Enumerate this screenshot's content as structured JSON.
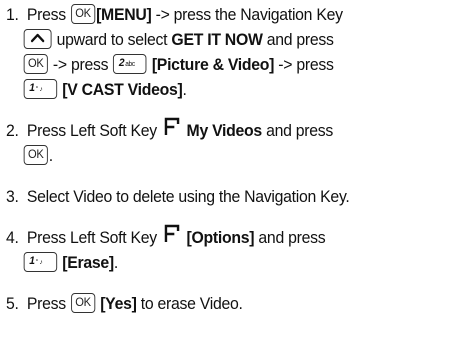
{
  "step1": {
    "num": "1.",
    "press1": "Press",
    "ok_key": "OK",
    "menu": "[MENU]",
    "arrow_text": "-> press the Navigation Key",
    "upward": "upward to select",
    "get_it_now": "GET IT NOW",
    "and_press": "and press",
    "arrow_press": "-> press",
    "key2_digit": "2",
    "key2_sub": "abc",
    "pic_video": "[Picture & Video]",
    "arrow_press2": "-> press",
    "key1_digit": "1",
    "key1_sub": "° ♪",
    "vcast": "[V CAST Videos]",
    "period": "."
  },
  "step2": {
    "num": "2.",
    "text": "Press Left Soft Key",
    "my_videos": "My Videos",
    "and_press": "and press",
    "ok_key": "OK",
    "period": "."
  },
  "step3": {
    "num": "3.",
    "text": "Select Video to delete using the Navigation Key."
  },
  "step4": {
    "num": "4.",
    "text": "Press Left Soft Key",
    "options": "[Options]",
    "and_press": "and press",
    "key1_digit": "1",
    "key1_sub": "° ♪",
    "erase": "[Erase]",
    "period": "."
  },
  "step5": {
    "num": "5.",
    "press": "Press",
    "ok_key": "OK",
    "yes": "[Yes]",
    "text": "to erase Video."
  }
}
